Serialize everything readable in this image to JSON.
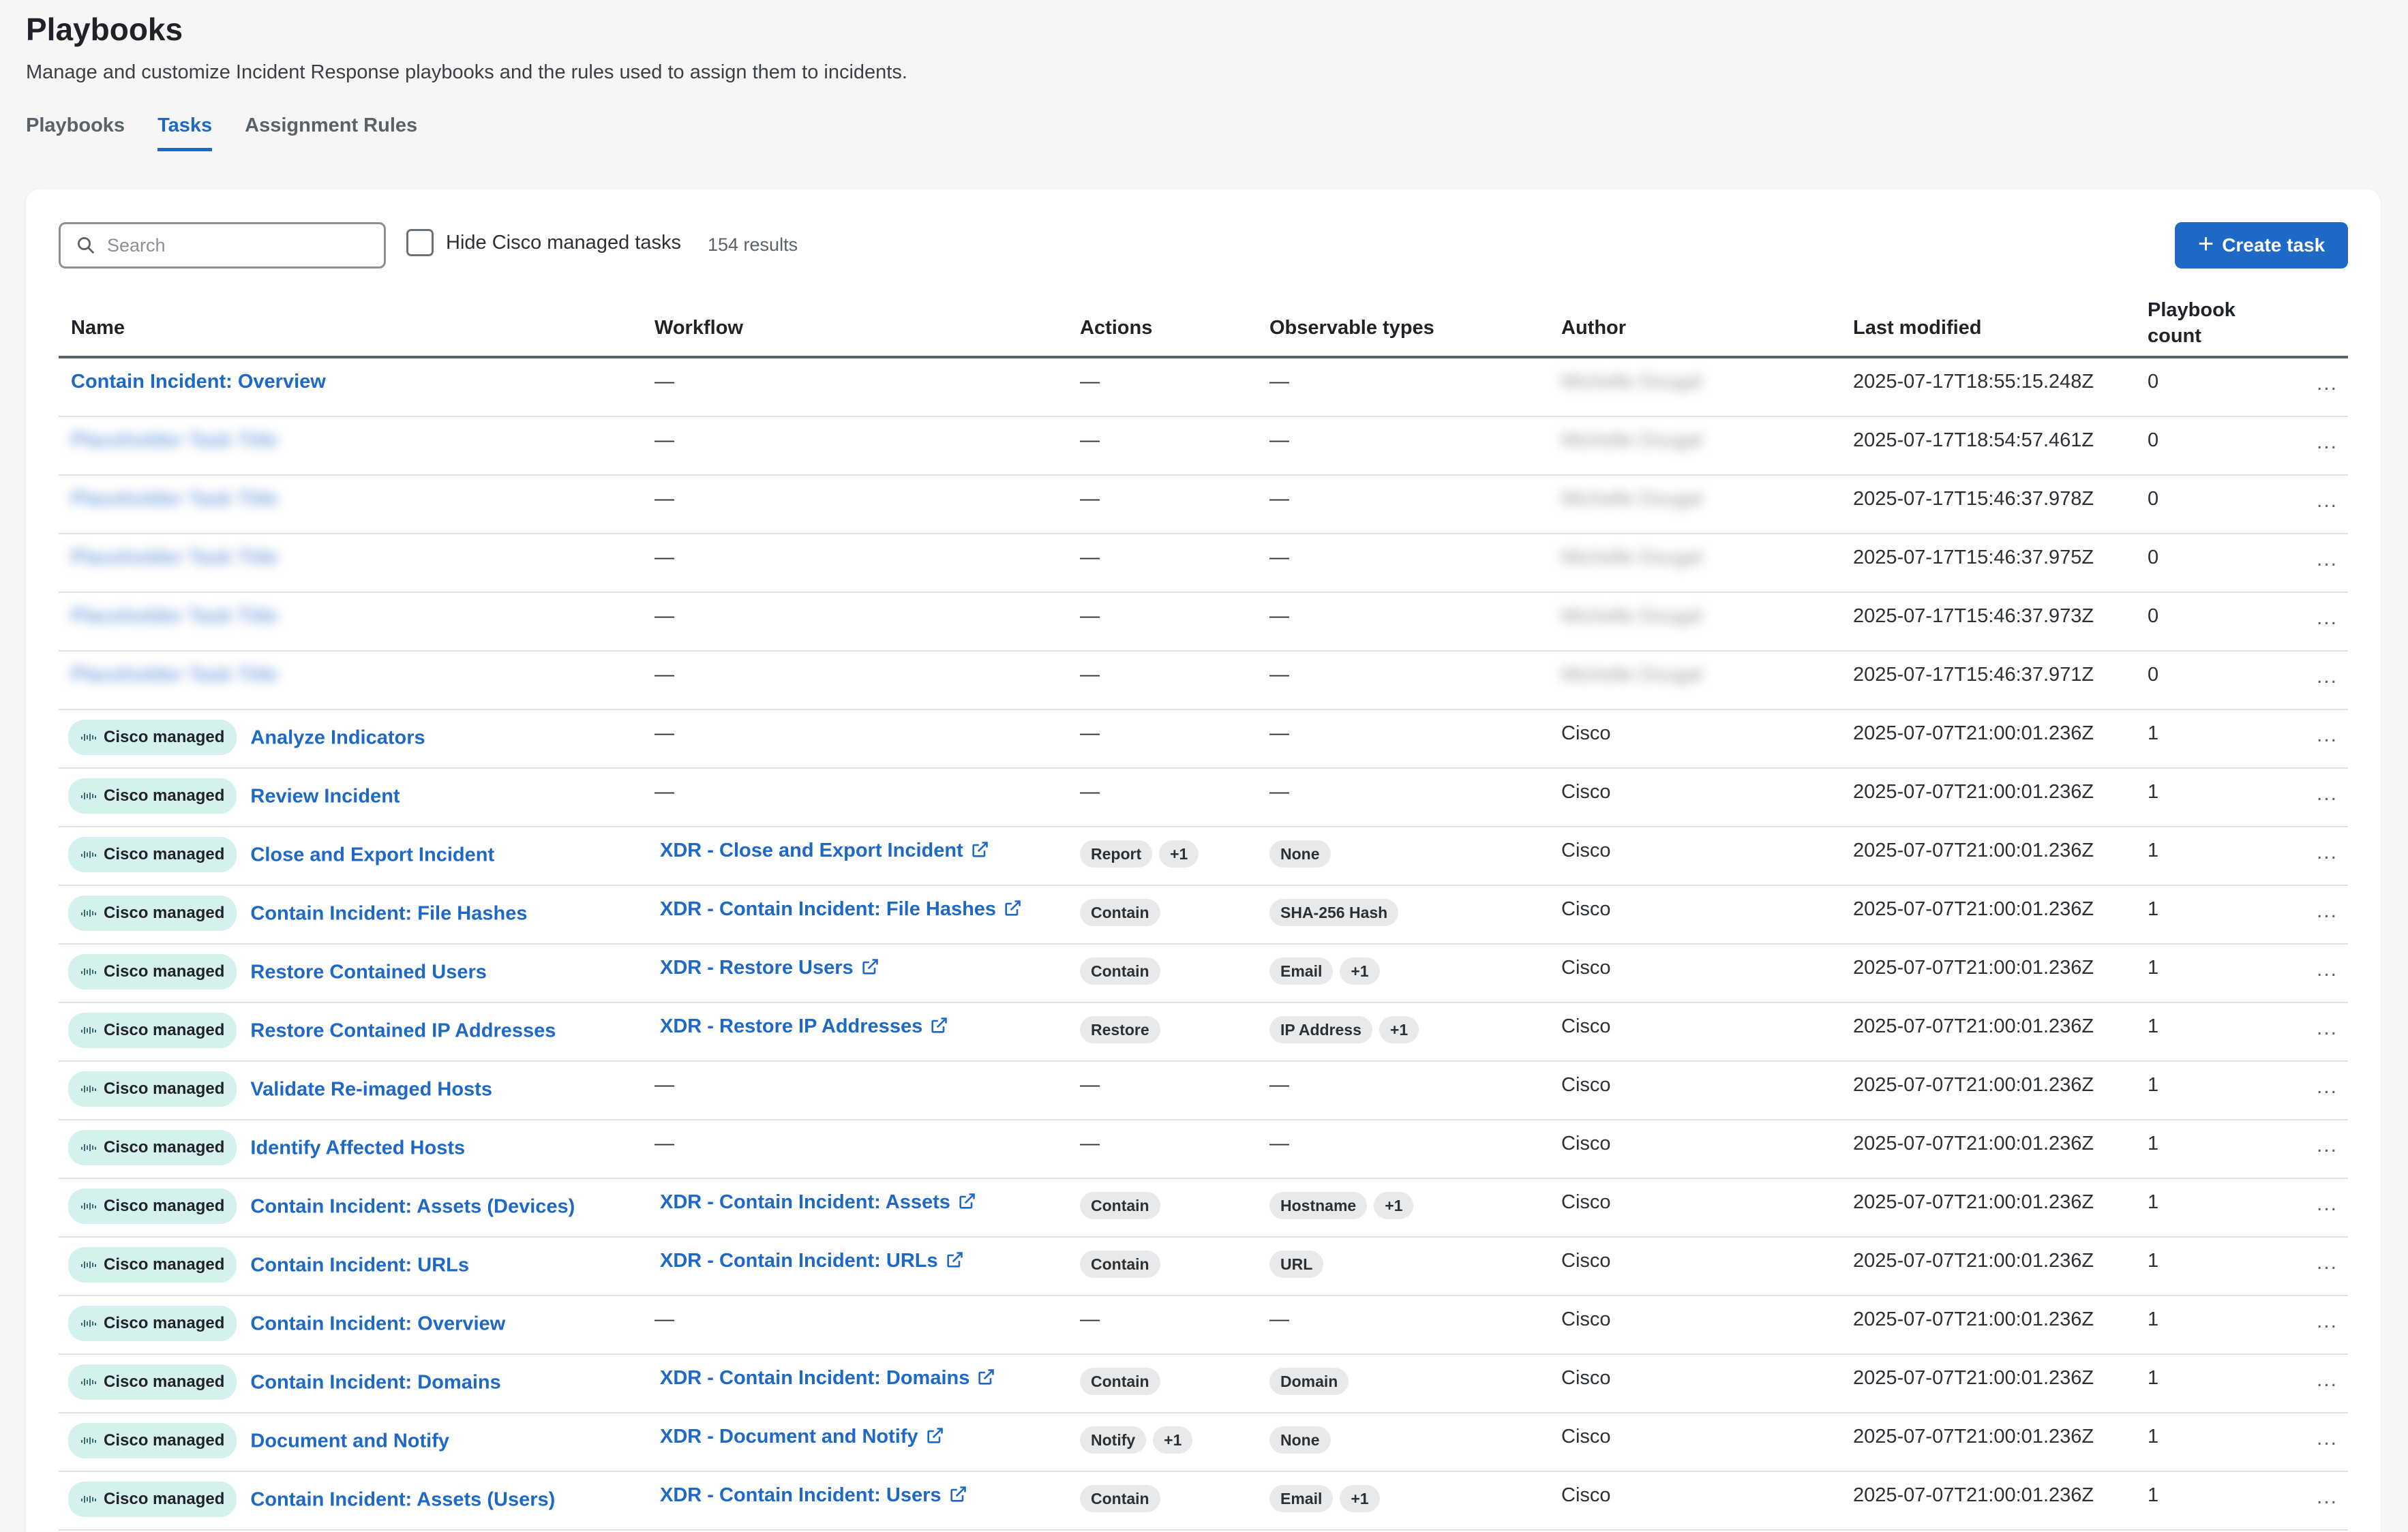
{
  "page": {
    "title": "Playbooks",
    "subtitle": "Manage and customize Incident Response playbooks and the rules used to assign them to incidents."
  },
  "tabs": [
    {
      "label": "Playbooks",
      "active": false
    },
    {
      "label": "Tasks",
      "active": true
    },
    {
      "label": "Assignment Rules",
      "active": false
    }
  ],
  "toolbar": {
    "search_placeholder": "Search",
    "hide_cisco_label": "Hide Cisco managed tasks",
    "results": "154 results",
    "create_label": "Create task"
  },
  "columns": {
    "name": "Name",
    "workflow": "Workflow",
    "actions": "Actions",
    "observable_types": "Observable types",
    "author": "Author",
    "last_modified": "Last modified",
    "playbook_count_1": "Playbook",
    "playbook_count_2": "count"
  },
  "badge_label": "Cisco managed",
  "dash": "—",
  "more_label": "...",
  "rows": [
    {
      "name": "Contain Incident: Overview",
      "cisco": false,
      "blurred": false,
      "workflow": "",
      "actions": [],
      "observables": [],
      "author": "Michelle Dougal",
      "author_blurred": true,
      "modified": "2025-07-17T18:55:15.248Z",
      "count": "0"
    },
    {
      "name": "Placeholder Task Title",
      "cisco": false,
      "blurred": true,
      "workflow": "",
      "actions": [],
      "observables": [],
      "author": "Michelle Dougal",
      "author_blurred": true,
      "modified": "2025-07-17T18:54:57.461Z",
      "count": "0"
    },
    {
      "name": "Placeholder Task Title",
      "cisco": false,
      "blurred": true,
      "workflow": "",
      "actions": [],
      "observables": [],
      "author": "Michelle Dougal",
      "author_blurred": true,
      "modified": "2025-07-17T15:46:37.978Z",
      "count": "0"
    },
    {
      "name": "Placeholder Task Title",
      "cisco": false,
      "blurred": true,
      "workflow": "",
      "actions": [],
      "observables": [],
      "author": "Michelle Dougal",
      "author_blurred": true,
      "modified": "2025-07-17T15:46:37.975Z",
      "count": "0"
    },
    {
      "name": "Placeholder Task Title",
      "cisco": false,
      "blurred": true,
      "workflow": "",
      "actions": [],
      "observables": [],
      "author": "Michelle Dougal",
      "author_blurred": true,
      "modified": "2025-07-17T15:46:37.973Z",
      "count": "0"
    },
    {
      "name": "Placeholder Task Title",
      "cisco": false,
      "blurred": true,
      "workflow": "",
      "actions": [],
      "observables": [],
      "author": "Michelle Dougal",
      "author_blurred": true,
      "modified": "2025-07-17T15:46:37.971Z",
      "count": "0"
    },
    {
      "name": "Analyze Indicators",
      "cisco": true,
      "blurred": false,
      "workflow": "",
      "actions": [],
      "observables": [],
      "author": "Cisco",
      "author_blurred": false,
      "modified": "2025-07-07T21:00:01.236Z",
      "count": "1"
    },
    {
      "name": "Review Incident",
      "cisco": true,
      "blurred": false,
      "workflow": "",
      "actions": [],
      "observables": [],
      "author": "Cisco",
      "author_blurred": false,
      "modified": "2025-07-07T21:00:01.236Z",
      "count": "1"
    },
    {
      "name": "Close and Export Incident",
      "cisco": true,
      "blurred": false,
      "workflow": "XDR - Close and Export Incident",
      "actions": [
        "Report",
        "+1"
      ],
      "observables": [
        "None"
      ],
      "author": "Cisco",
      "author_blurred": false,
      "modified": "2025-07-07T21:00:01.236Z",
      "count": "1"
    },
    {
      "name": "Contain Incident: File Hashes",
      "cisco": true,
      "blurred": false,
      "workflow": "XDR - Contain Incident: File Hashes",
      "actions": [
        "Contain"
      ],
      "observables": [
        "SHA-256 Hash"
      ],
      "author": "Cisco",
      "author_blurred": false,
      "modified": "2025-07-07T21:00:01.236Z",
      "count": "1"
    },
    {
      "name": "Restore Contained Users",
      "cisco": true,
      "blurred": false,
      "workflow": "XDR - Restore Users",
      "actions": [
        "Contain"
      ],
      "observables": [
        "Email",
        "+1"
      ],
      "author": "Cisco",
      "author_blurred": false,
      "modified": "2025-07-07T21:00:01.236Z",
      "count": "1"
    },
    {
      "name": "Restore Contained IP Addresses",
      "cisco": true,
      "blurred": false,
      "workflow": "XDR - Restore IP Addresses",
      "actions": [
        "Restore"
      ],
      "observables": [
        "IP Address",
        "+1"
      ],
      "author": "Cisco",
      "author_blurred": false,
      "modified": "2025-07-07T21:00:01.236Z",
      "count": "1"
    },
    {
      "name": "Validate Re-imaged Hosts",
      "cisco": true,
      "blurred": false,
      "workflow": "",
      "actions": [],
      "observables": [],
      "author": "Cisco",
      "author_blurred": false,
      "modified": "2025-07-07T21:00:01.236Z",
      "count": "1"
    },
    {
      "name": "Identify Affected Hosts",
      "cisco": true,
      "blurred": false,
      "workflow": "",
      "actions": [],
      "observables": [],
      "author": "Cisco",
      "author_blurred": false,
      "modified": "2025-07-07T21:00:01.236Z",
      "count": "1"
    },
    {
      "name": "Contain Incident: Assets (Devices)",
      "cisco": true,
      "blurred": false,
      "workflow": "XDR - Contain Incident: Assets",
      "actions": [
        "Contain"
      ],
      "observables": [
        "Hostname",
        "+1"
      ],
      "author": "Cisco",
      "author_blurred": false,
      "modified": "2025-07-07T21:00:01.236Z",
      "count": "1"
    },
    {
      "name": "Contain Incident: URLs",
      "cisco": true,
      "blurred": false,
      "workflow": "XDR - Contain Incident: URLs",
      "actions": [
        "Contain"
      ],
      "observables": [
        "URL"
      ],
      "author": "Cisco",
      "author_blurred": false,
      "modified": "2025-07-07T21:00:01.236Z",
      "count": "1"
    },
    {
      "name": "Contain Incident: Overview",
      "cisco": true,
      "blurred": false,
      "workflow": "",
      "actions": [],
      "observables": [],
      "author": "Cisco",
      "author_blurred": false,
      "modified": "2025-07-07T21:00:01.236Z",
      "count": "1"
    },
    {
      "name": "Contain Incident: Domains",
      "cisco": true,
      "blurred": false,
      "workflow": "XDR - Contain Incident: Domains",
      "actions": [
        "Contain"
      ],
      "observables": [
        "Domain"
      ],
      "author": "Cisco",
      "author_blurred": false,
      "modified": "2025-07-07T21:00:01.236Z",
      "count": "1"
    },
    {
      "name": "Document and Notify",
      "cisco": true,
      "blurred": false,
      "workflow": "XDR - Document and Notify",
      "actions": [
        "Notify",
        "+1"
      ],
      "observables": [
        "None"
      ],
      "author": "Cisco",
      "author_blurred": false,
      "modified": "2025-07-07T21:00:01.236Z",
      "count": "1"
    },
    {
      "name": "Contain Incident: Assets (Users)",
      "cisco": true,
      "blurred": false,
      "workflow": "XDR - Contain Incident: Users",
      "actions": [
        "Contain"
      ],
      "observables": [
        "Email",
        "+1"
      ],
      "author": "Cisco",
      "author_blurred": false,
      "modified": "2025-07-07T21:00:01.236Z",
      "count": "1"
    }
  ]
}
